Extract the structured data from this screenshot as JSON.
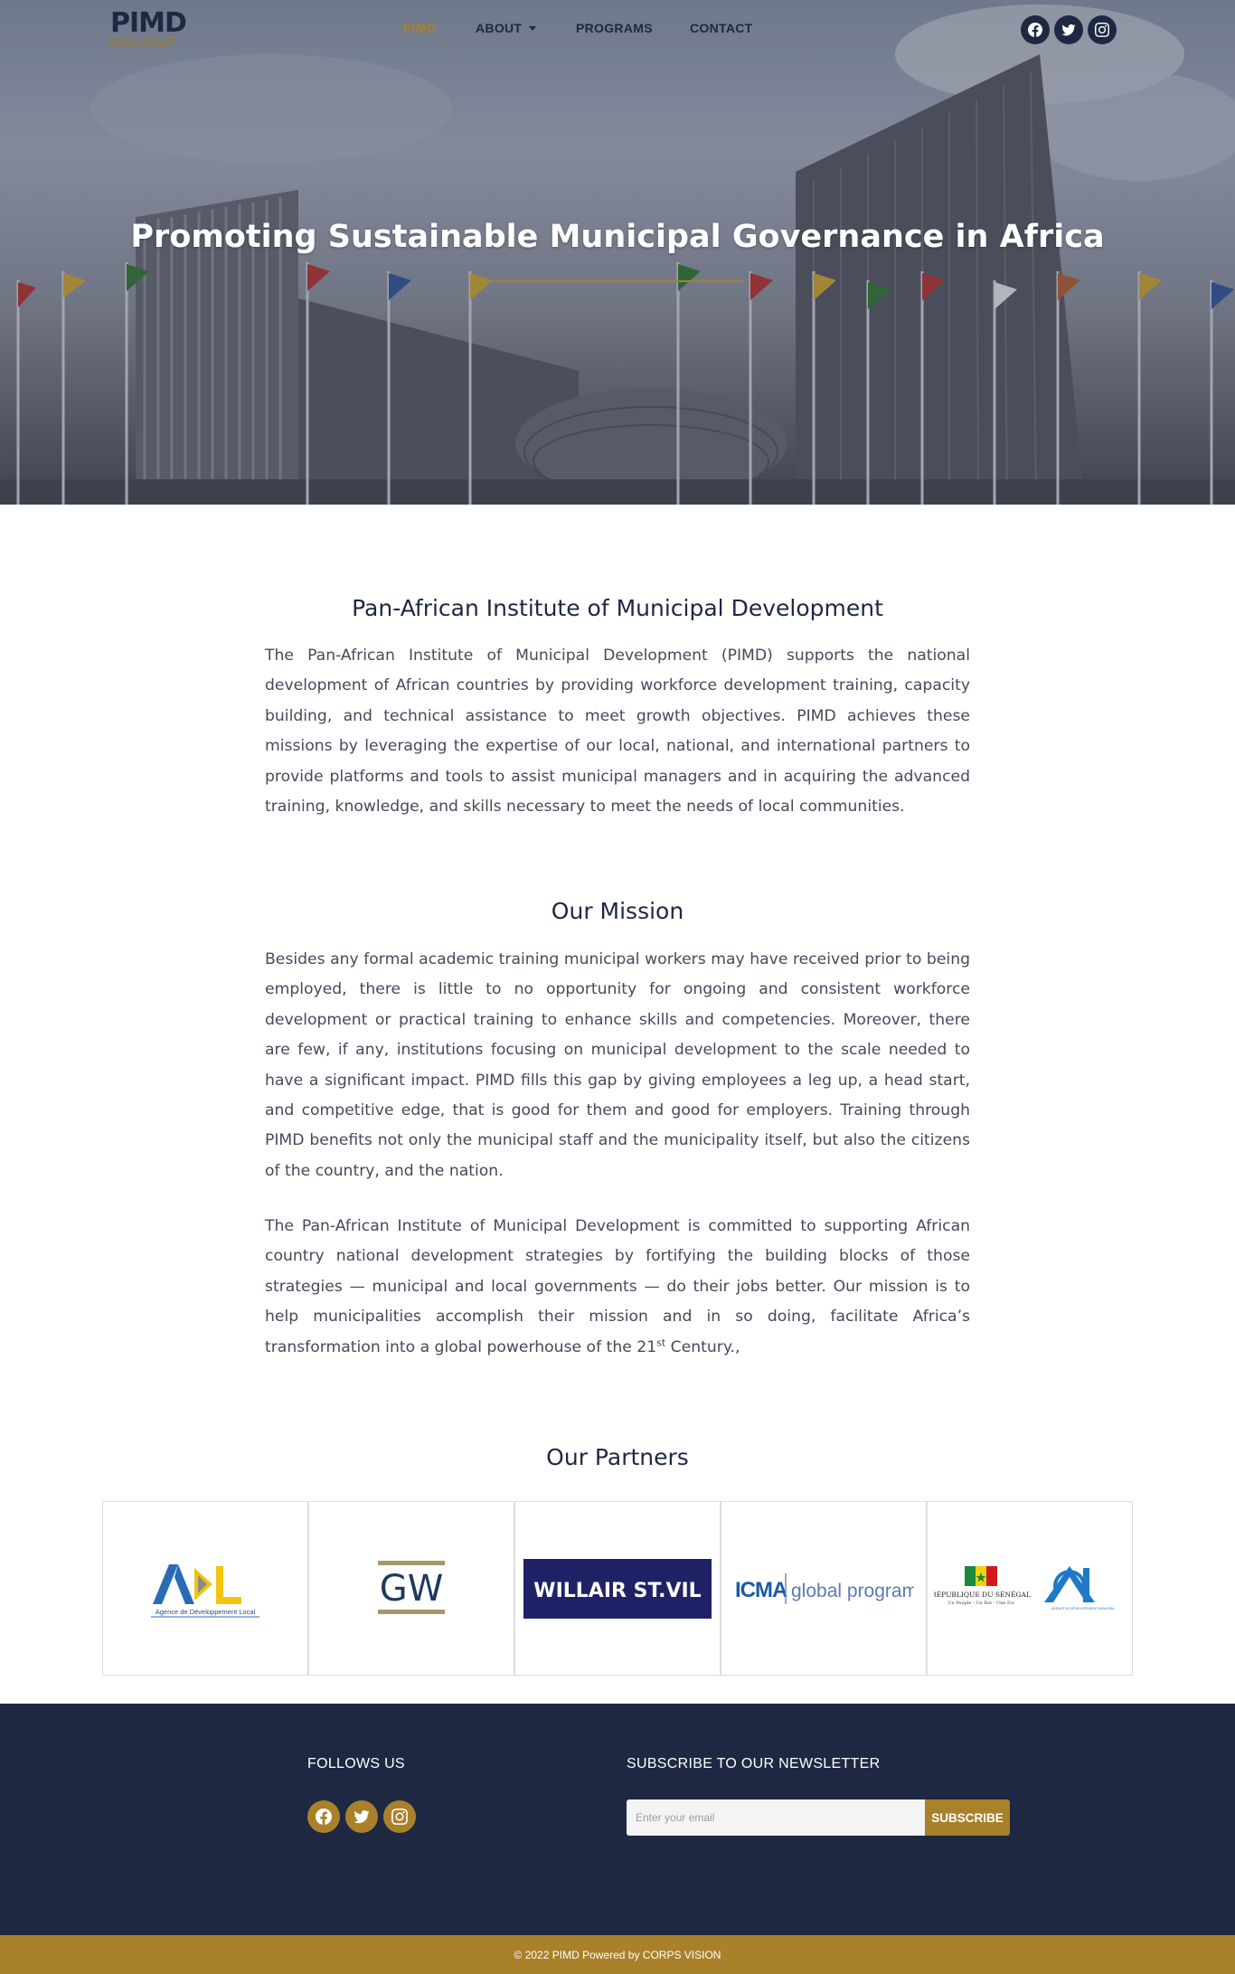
{
  "brand": {
    "logo_text": "PIMD",
    "logo_subtitle": "PAN-AFRICAN INSTITUTE OF MUNICIPAL DEVELOPMENT"
  },
  "nav": {
    "items": [
      {
        "label": "PIMD",
        "active": true
      },
      {
        "label": "ABOUT",
        "has_dropdown": true
      },
      {
        "label": "PROGRAMS"
      },
      {
        "label": "CONTACT"
      }
    ],
    "social_icons": [
      "facebook-icon",
      "twitter-icon",
      "instagram-icon"
    ]
  },
  "hero": {
    "title": "Promoting Sustainable Municipal Governance in Africa"
  },
  "about": {
    "heading": "Pan-African Institute of Municipal Development",
    "body": "The Pan-African Institute of Municipal Development (PIMD) supports the national development of African countries by providing workforce development training, capacity building, and technical assistance to meet growth objectives. PIMD achieves these missions by leveraging the expertise of our local, national, and international partners to provide platforms and tools to assist municipal managers and in acquiring the advanced training, knowledge, and skills necessary to meet the needs of local communities."
  },
  "mission": {
    "heading": "Our Mission",
    "para1": "Besides any formal academic training municipal workers may have received prior to being employed, there is little to no opportunity for ongoing and consistent workforce development or practical training to enhance skills and competencies. Moreover, there are few, if any, institutions focusing on municipal development to the scale needed to have a significant impact.   PIMD fills this gap by giving employees a leg up, a head start, and competitive edge, that is good for them and good for employers.  Training through PIMD benefits not only the municipal staff and the municipality itself, but also the citizens of the country, and the nation.",
    "para2_start": "The Pan-African Institute of Municipal Development is committed to supporting African country national development strategies by fortifying the building blocks of those strategies — municipal and local governments — do their jobs better.  Our mission is to help municipalities accomplish their mission and in so doing, facilitate Africa’s transformation into a global powerhouse of the 21",
    "para2_sup": "st",
    "para2_end": " Century.,"
  },
  "partners": {
    "heading": "Our Partners",
    "logos": [
      {
        "name": "adl",
        "caption": "Agence de Développement Local"
      },
      {
        "name": "gw",
        "text": "GW"
      },
      {
        "name": "willair",
        "text": "WILLAIR ST.VIL"
      },
      {
        "name": "icma",
        "text_a": "ICMA",
        "text_b": "global programs"
      },
      {
        "name": "senegal",
        "text_a": "RÉPUBLIQUE DU SÉNÉGAL",
        "text_b": "Un Peuple - Un But - Une Foi",
        "text_c": "AGENCE DE DÉVELOPPEMENT MUNICIPAL"
      }
    ]
  },
  "footer": {
    "follow_heading": "FOLLOWS US",
    "newsletter_heading": "SUBSCRIBE TO OUR NEWSLETTER",
    "email_placeholder": "Enter your email",
    "subscribe_label": "SUBSCRIBE",
    "copyright": "© 2022 PIMD Powered by CORPS VISION"
  },
  "colors": {
    "navy": "#1e2842",
    "gold": "#a8812a"
  }
}
